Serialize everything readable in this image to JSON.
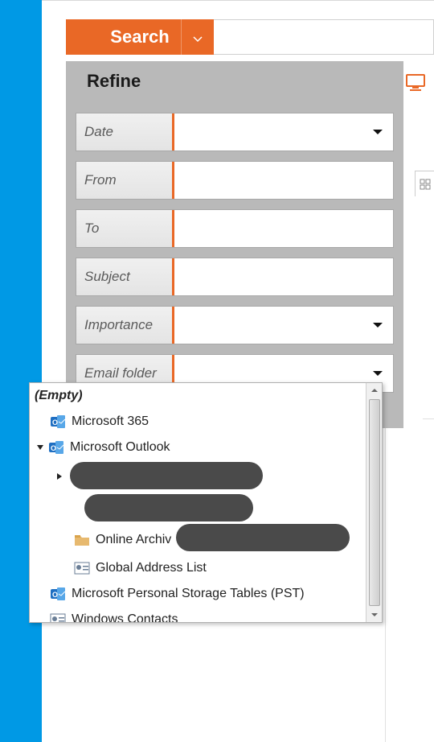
{
  "searchBar": {
    "buttonLabel": "Search"
  },
  "refine": {
    "tabLabel": "Refine",
    "fields": {
      "date": "Date",
      "from": "From",
      "to": "To",
      "subject": "Subject",
      "importance": "Importance",
      "emailFolder": "Email folder"
    }
  },
  "folderDropdown": {
    "empty": "(Empty)",
    "items": {
      "m365": "Microsoft 365",
      "outlook": "Microsoft Outlook",
      "onlineArchive": "Online Archiv",
      "gal": "Global Address List",
      "pst": "Microsoft Personal Storage Tables (PST)",
      "winContacts": "Windows Contacts"
    }
  },
  "colors": {
    "accent": "#e96826",
    "taskbar": "#0099e5",
    "panelGrey": "#b9b9b9"
  }
}
